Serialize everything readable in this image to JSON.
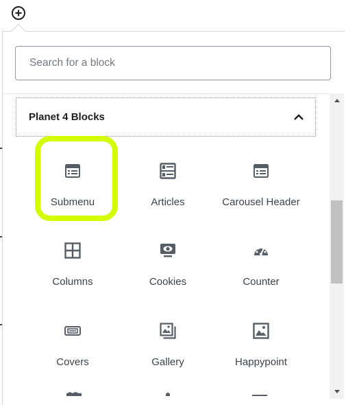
{
  "toolbar": {
    "inserter_icon": "plus-circle-icon"
  },
  "search": {
    "placeholder": "Search for a block",
    "value": ""
  },
  "panel": {
    "title": "Planet 4 Blocks",
    "expanded": true,
    "toggle_icon": "chevron-up-icon"
  },
  "blocks": [
    {
      "label": "Submenu",
      "icon": "submenu-icon",
      "highlighted": true
    },
    {
      "label": "Articles",
      "icon": "articles-icon"
    },
    {
      "label": "Carousel Header",
      "icon": "carousel-header-icon"
    },
    {
      "label": "Columns",
      "icon": "columns-icon"
    },
    {
      "label": "Cookies",
      "icon": "cookies-icon"
    },
    {
      "label": "Counter",
      "icon": "counter-icon"
    },
    {
      "label": "Covers",
      "icon": "covers-icon"
    },
    {
      "label": "Gallery",
      "icon": "gallery-icon"
    },
    {
      "label": "Happypoint",
      "icon": "happypoint-icon"
    }
  ],
  "colors": {
    "highlight": "#d4fb00",
    "icon": "#555d66",
    "text": "#3c434a"
  }
}
